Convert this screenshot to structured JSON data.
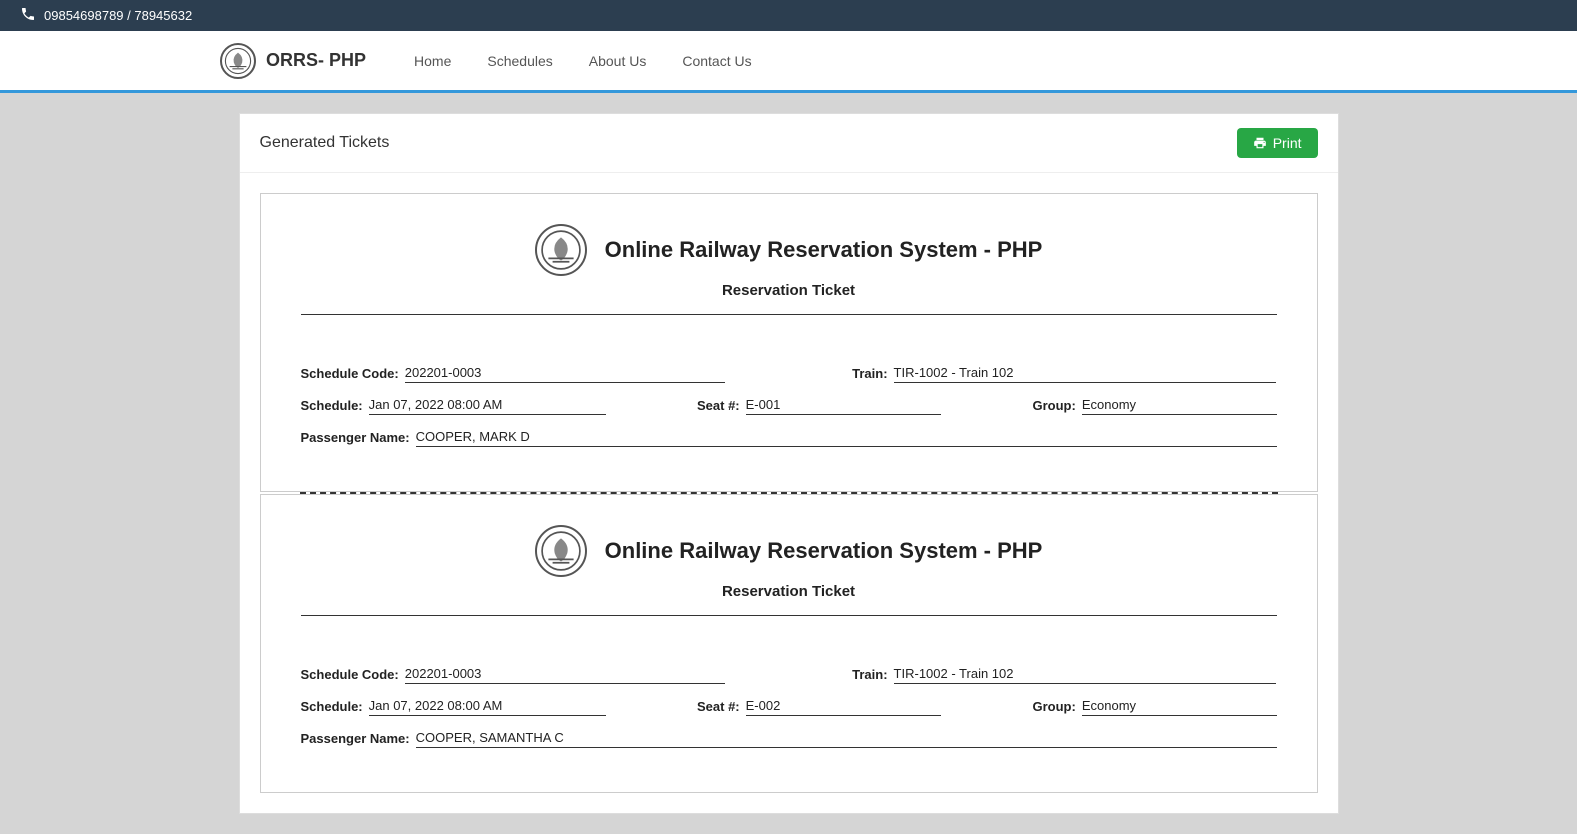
{
  "topbar": {
    "phone": "09854698789 / 78945632"
  },
  "navbar": {
    "brand": "ORRS- PHP",
    "links": [
      {
        "label": "Home",
        "href": "#"
      },
      {
        "label": "Schedules",
        "href": "#"
      },
      {
        "label": "About Us",
        "href": "#"
      },
      {
        "label": "Contact Us",
        "href": "#"
      }
    ]
  },
  "page": {
    "title": "Generated Tickets",
    "print_label": "Print"
  },
  "tickets": [
    {
      "system_name": "Online Railway Reservation System - PHP",
      "ticket_type": "Reservation Ticket",
      "schedule_code_label": "Schedule Code:",
      "schedule_code_value": "202201-0003",
      "train_label": "Train:",
      "train_value": "TIR-1002 - Train 102",
      "schedule_label": "Schedule:",
      "schedule_value": "Jan 07, 2022 08:00 AM",
      "seat_label": "Seat #:",
      "seat_value": "E-001",
      "group_label": "Group:",
      "group_value": "Economy",
      "passenger_label": "Passenger Name:",
      "passenger_value": "COOPER, MARK D"
    },
    {
      "system_name": "Online Railway Reservation System - PHP",
      "ticket_type": "Reservation Ticket",
      "schedule_code_label": "Schedule Code:",
      "schedule_code_value": "202201-0003",
      "train_label": "Train:",
      "train_value": "TIR-1002 - Train 102",
      "schedule_label": "Schedule:",
      "schedule_value": "Jan 07, 2022 08:00 AM",
      "seat_label": "Seat #:",
      "seat_value": "E-002",
      "group_label": "Group:",
      "group_value": "Economy",
      "passenger_label": "Passenger Name:",
      "passenger_value": "COOPER, SAMANTHA C"
    }
  ]
}
